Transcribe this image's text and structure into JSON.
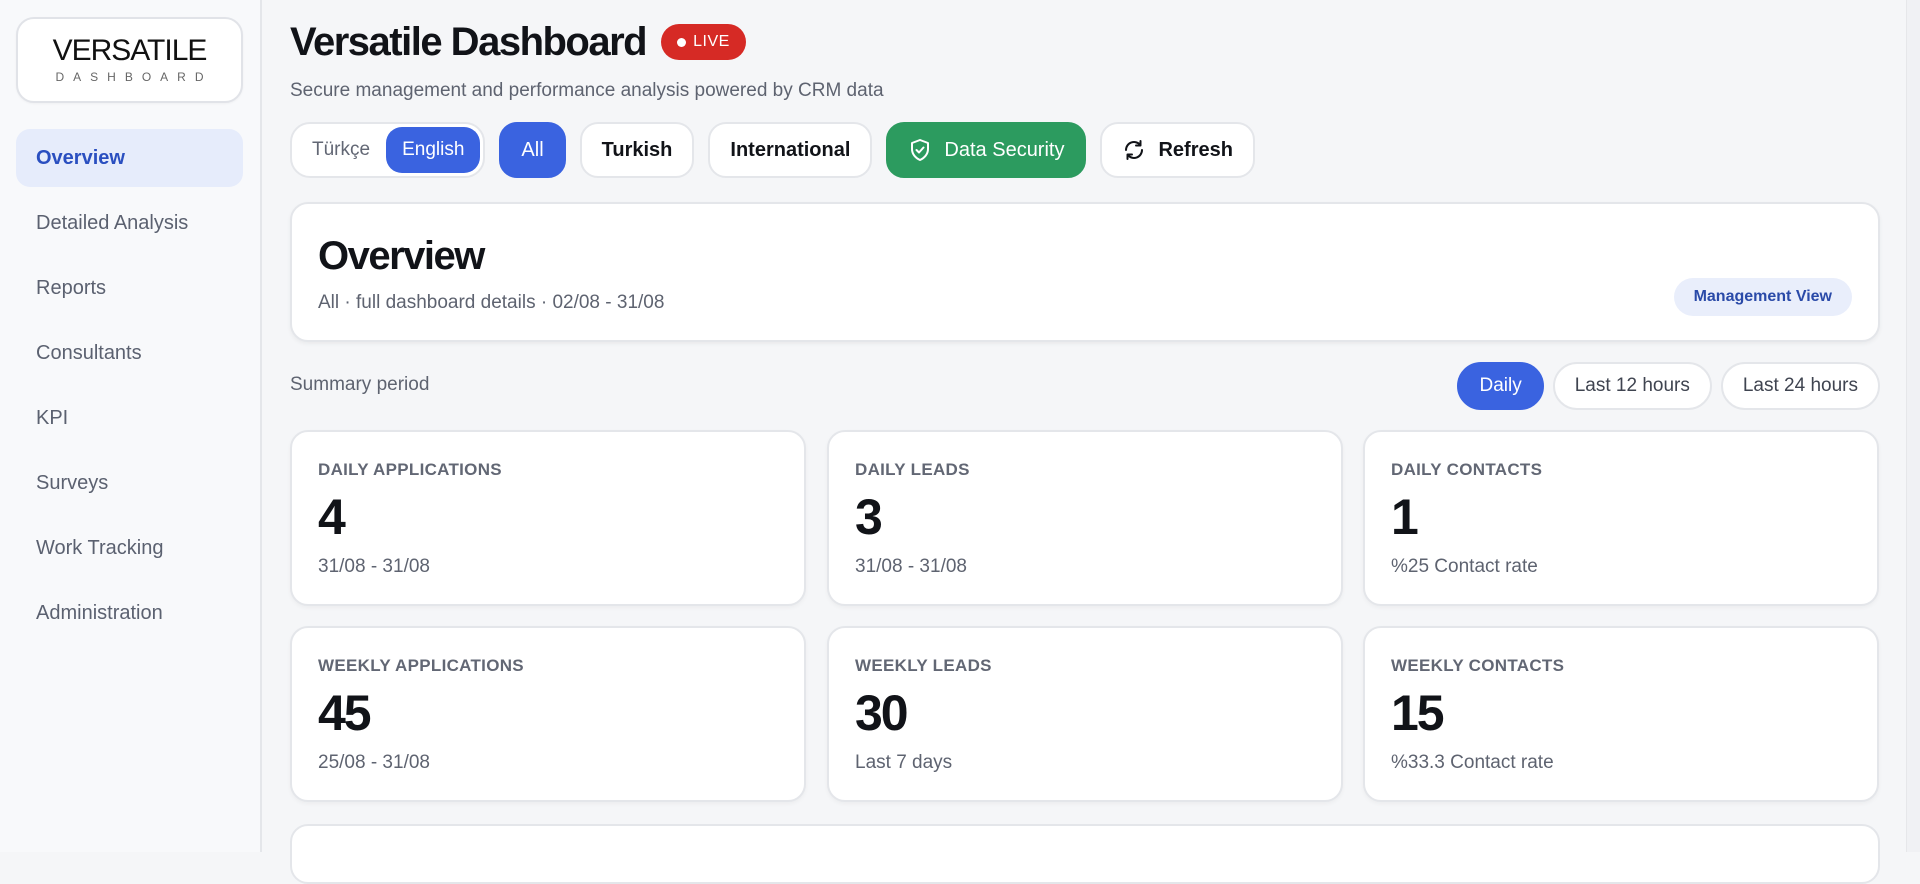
{
  "logo": {
    "main": "VERSATILE",
    "sub": "DASHBOARD"
  },
  "sidebar": {
    "items": [
      {
        "label": "Overview",
        "active": true
      },
      {
        "label": "Detailed Analysis"
      },
      {
        "label": "Reports"
      },
      {
        "label": "Consultants"
      },
      {
        "label": "KPI"
      },
      {
        "label": "Surveys"
      },
      {
        "label": "Work Tracking"
      },
      {
        "label": "Administration"
      }
    ]
  },
  "header": {
    "title": "Versatile Dashboard",
    "live_label": "LIVE",
    "subtitle": "Secure management and performance analysis powered by CRM data"
  },
  "toolbar": {
    "lang_tr": "Türkçe",
    "lang_en": "English",
    "filter_all": "All",
    "filter_turkish": "Turkish",
    "filter_international": "International",
    "data_security": "Data Security",
    "refresh": "Refresh"
  },
  "overview": {
    "title": "Overview",
    "subtitle": "All · full dashboard details · 02/08 - 31/08",
    "badge": "Management View"
  },
  "period": {
    "label": "Summary period",
    "options": [
      "Daily",
      "Last 12 hours",
      "Last 24 hours"
    ],
    "selected": "Daily"
  },
  "stats": [
    {
      "label": "DAILY APPLICATIONS",
      "value": "4",
      "note": "31/08 - 31/08"
    },
    {
      "label": "DAILY LEADS",
      "value": "3",
      "note": "31/08 - 31/08"
    },
    {
      "label": "DAILY CONTACTS",
      "value": "1",
      "note": "%25 Contact rate"
    },
    {
      "label": "WEEKLY APPLICATIONS",
      "value": "45",
      "note": "25/08 - 31/08"
    },
    {
      "label": "WEEKLY LEADS",
      "value": "30",
      "note": "Last 7 days"
    },
    {
      "label": "WEEKLY CONTACTS",
      "value": "15",
      "note": "%33.3 Contact rate"
    }
  ],
  "colors": {
    "accent": "#3a63e0",
    "live": "#d62a25",
    "security": "#2c9b5f",
    "nav_active_bg": "#e6ecfb"
  },
  "icons": {
    "security": "shield-check-icon",
    "refresh": "refresh-icon"
  }
}
